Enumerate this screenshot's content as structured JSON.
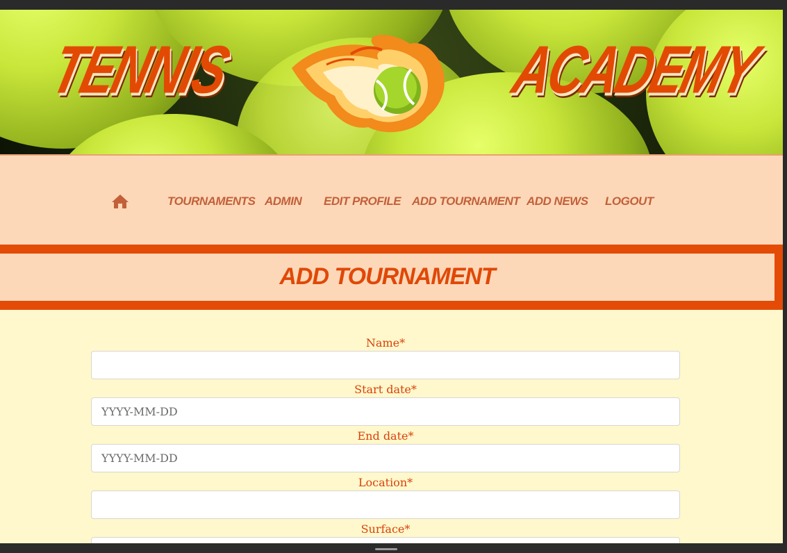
{
  "banner": {
    "left_word": "TENNIS",
    "right_word": "ACADEMY"
  },
  "nav": {
    "home_icon": "home-icon",
    "items": [
      {
        "label": "TOURNAMENTS"
      },
      {
        "label": "ADMIN"
      },
      {
        "label": "EDIT PROFILE"
      },
      {
        "label": "ADD TOURNAMENT"
      },
      {
        "label": "ADD NEWS"
      },
      {
        "label": "LOGOUT"
      }
    ]
  },
  "page": {
    "title": "ADD TOURNAMENT"
  },
  "form": {
    "name": {
      "label": "Name*",
      "value": "",
      "placeholder": ""
    },
    "start_date": {
      "label": "Start date*",
      "value": "",
      "placeholder": "YYYY-MM-DD"
    },
    "end_date": {
      "label": "End date*",
      "value": "",
      "placeholder": "YYYY-MM-DD"
    },
    "location": {
      "label": "Location*",
      "value": "",
      "placeholder": ""
    },
    "surface": {
      "label": "Surface*"
    }
  },
  "colors": {
    "accent": "#e34b07",
    "nav_bg": "#fdd8b8",
    "nav_text": "#c2603a",
    "page_bg": "#fff8cc",
    "label": "#d8420b"
  }
}
